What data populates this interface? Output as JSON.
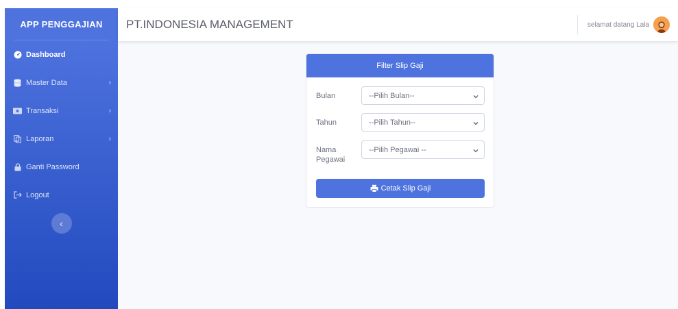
{
  "sidebar": {
    "brand": "APP PENGGAJIAN",
    "items": [
      {
        "label": "Dashboard",
        "icon": "tachometer-icon",
        "active": true
      },
      {
        "label": "Master Data",
        "icon": "database-icon",
        "chevron": true
      },
      {
        "label": "Transaksi",
        "icon": "money-icon",
        "chevron": true
      },
      {
        "label": "Laporan",
        "icon": "copy-icon",
        "chevron": true
      },
      {
        "label": "Ganti Password",
        "icon": "lock-icon"
      },
      {
        "label": "Logout",
        "icon": "sign-out-icon"
      }
    ],
    "toggle_glyph": "‹"
  },
  "topbar": {
    "company": "PT.INDONESIA MANAGEMENT",
    "greeting": "selamat datang Lala"
  },
  "card": {
    "title": "Filter Slip Gaji",
    "fields": [
      {
        "label": "Bulan",
        "value": "--Pilih Bulan--"
      },
      {
        "label": "Tahun",
        "value": "--Pilih Tahun--"
      },
      {
        "label": "Nama Pegawai",
        "value": "--Pilih Pegawai --"
      }
    ],
    "button": "Cetak Slip Gaji"
  },
  "colors": {
    "primary": "#4e73df",
    "sidebar_bottom": "#224abe",
    "background": "#f8f9fc"
  }
}
